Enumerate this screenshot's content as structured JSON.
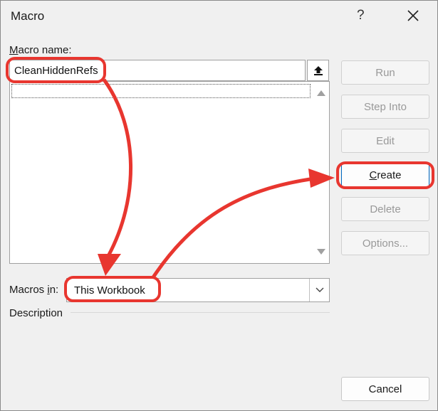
{
  "dialog": {
    "title": "Macro",
    "help_label": "?",
    "close_icon": "close-icon"
  },
  "macro_name": {
    "label_first": "M",
    "label_rest": "acro name:",
    "value": "CleanHiddenRefs"
  },
  "buttons": {
    "run": "Run",
    "step_into": "Step Into",
    "edit": "Edit",
    "create_first": "C",
    "create_rest": "reate",
    "delete": "Delete",
    "options": "Options...",
    "cancel": "Cancel"
  },
  "macros_in": {
    "label_first": "Macros ",
    "label_underlined": "i",
    "label_rest": "n:",
    "value": "This Workbook"
  },
  "description": {
    "label": "Description"
  },
  "colors": {
    "annotation_red": "#e8362f",
    "accent_blue": "#0067c0"
  }
}
